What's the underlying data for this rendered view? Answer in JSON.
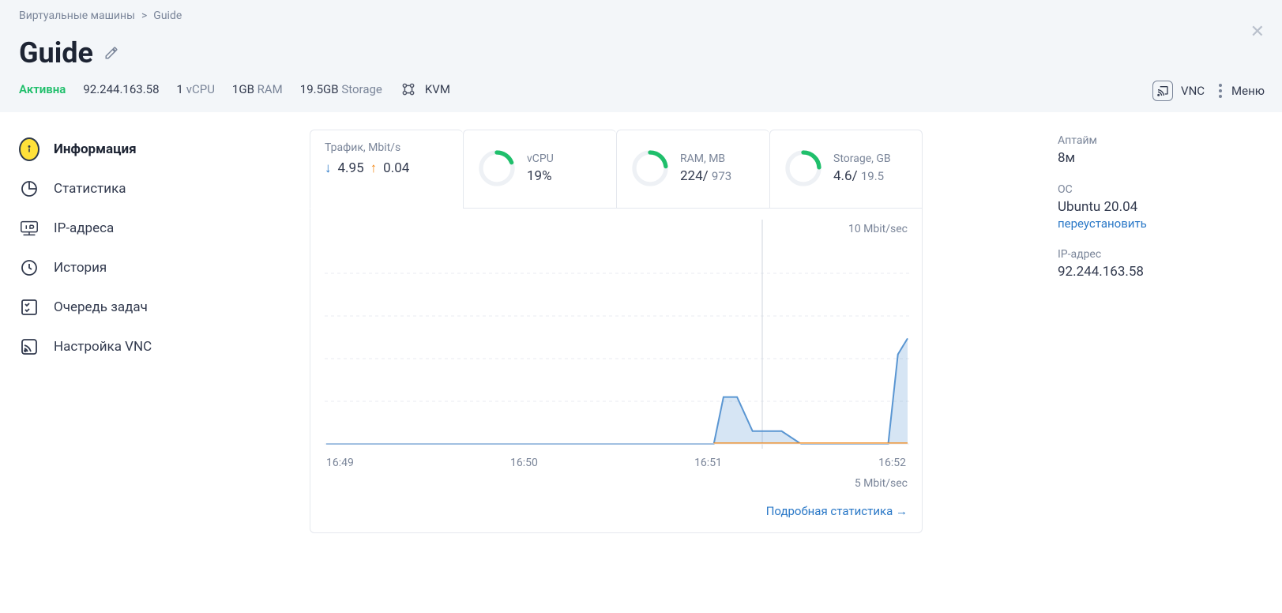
{
  "breadcrumb": {
    "root": "Виртуальные машины",
    "sep": ">",
    "current": "Guide"
  },
  "title": "Guide",
  "status": "Активна",
  "meta": {
    "ip": "92.244.163.58",
    "vcpu_num": "1",
    "vcpu_lbl": "vCPU",
    "ram_num": "1GB",
    "ram_lbl": "RAM",
    "storage_num": "19.5GB",
    "storage_lbl": "Storage",
    "kvm": "KVM"
  },
  "header_actions": {
    "vnc": "VNC",
    "menu": "Меню"
  },
  "sidebar": [
    {
      "label": "Информация"
    },
    {
      "label": "Статистика"
    },
    {
      "label": "IP-адреса"
    },
    {
      "label": "История"
    },
    {
      "label": "Очередь задач"
    },
    {
      "label": "Настройка VNC"
    }
  ],
  "cards": {
    "traffic": {
      "title": "Трафик, Mbit/s",
      "down": "4.95",
      "up": "0.04"
    },
    "vcpu": {
      "title": "vCPU",
      "value": "19%",
      "pct": 19
    },
    "ram": {
      "title": "RAM, MB",
      "used": "224",
      "total": "973",
      "pct": 23
    },
    "storage": {
      "title": "Storage, GB",
      "used": "4.6",
      "total": "19.5",
      "pct": 24
    }
  },
  "chart": {
    "top_label": "10 Mbit/sec",
    "bottom_label": "5 Mbit/sec",
    "x_ticks": [
      "16:49",
      "16:50",
      "16:51",
      "16:52"
    ]
  },
  "more_stats": "Подробная статистика  →",
  "right": {
    "uptime_label": "Аптайм",
    "uptime": "8м",
    "os_label": "ОС",
    "os": "Ubuntu 20.04",
    "reinstall": "переустановить",
    "ip_label": "IP-адрес",
    "ip": "92.244.163.58"
  },
  "chart_data": {
    "type": "line",
    "title": "Трафик, Mbit/s",
    "xlabel": "",
    "ylabel": "Mbit/sec",
    "ylim": [
      0,
      10
    ],
    "x": [
      "16:49",
      "16:50",
      "16:51",
      "16:52"
    ],
    "series": [
      {
        "name": "download",
        "color": "#2a78c7",
        "values_by_minute": [
          {
            "t": "16:49",
            "v": 0
          },
          {
            "t": "16:50",
            "v": 0
          },
          {
            "t": "16:51.0",
            "v": 0
          },
          {
            "t": "16:51.05",
            "v": 2.2
          },
          {
            "t": "16:51.12",
            "v": 2.2
          },
          {
            "t": "16:51.2",
            "v": 0.6
          },
          {
            "t": "16:51.35",
            "v": 0.6
          },
          {
            "t": "16:51.45",
            "v": 0
          },
          {
            "t": "16:51.9",
            "v": 0
          },
          {
            "t": "16:51.95",
            "v": 4.2
          },
          {
            "t": "16:52",
            "v": 4.95
          }
        ]
      },
      {
        "name": "upload",
        "color": "#f28a1c",
        "values_by_minute": [
          {
            "t": "16:49",
            "v": 0
          },
          {
            "t": "16:51",
            "v": 0.04
          },
          {
            "t": "16:52",
            "v": 0.04
          }
        ]
      }
    ]
  }
}
